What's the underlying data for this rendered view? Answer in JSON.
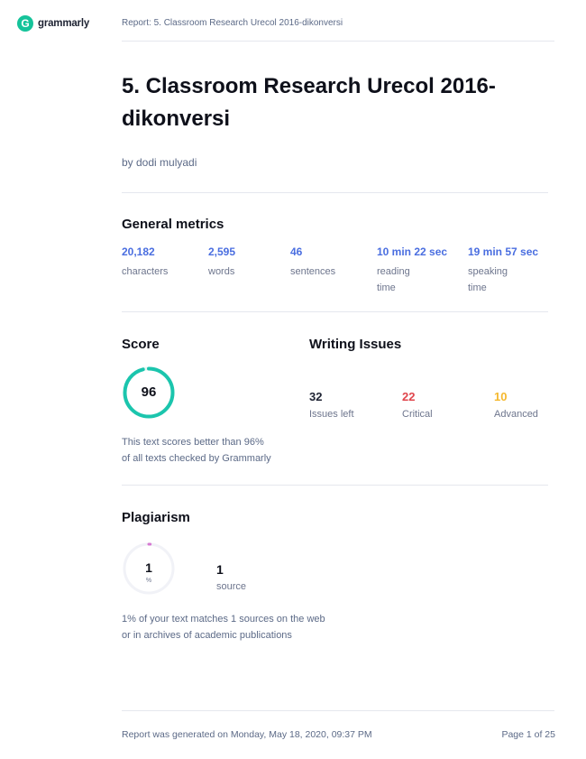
{
  "header": {
    "brand": "grammarly",
    "brand_mark": "G",
    "report_title": "Report: 5. Classroom Research Urecol 2016-dikonversi"
  },
  "document": {
    "title": "5. Classroom Research Urecol 2016-dikonversi",
    "author": "by dodi mulyadi"
  },
  "general_metrics": {
    "heading": "General metrics",
    "items": [
      {
        "value": "20,182",
        "label": "characters"
      },
      {
        "value": "2,595",
        "label": "words"
      },
      {
        "value": "46",
        "label": "sentences"
      },
      {
        "value": "10 min 22 sec",
        "label": "reading",
        "label2": "time"
      },
      {
        "value": "19 min 57 sec",
        "label": "speaking",
        "label2": "time"
      }
    ]
  },
  "score": {
    "heading": "Score",
    "value": "96",
    "percent": 96,
    "caption_line1": "This text scores better than 96%",
    "caption_line2": "of all texts checked by Grammarly"
  },
  "writing_issues": {
    "heading": "Writing Issues",
    "items": [
      {
        "value": "32",
        "label": "Issues left",
        "color": "#1d2232"
      },
      {
        "value": "22",
        "label": "Critical",
        "color": "#e0454c"
      },
      {
        "value": "10",
        "label": "Advanced",
        "color": "#f5b82e"
      }
    ]
  },
  "plagiarism": {
    "heading": "Plagiarism",
    "value": "1",
    "unit": "%",
    "percent": 1,
    "sources_value": "1",
    "sources_label": "source",
    "caption_line1": "1% of your text matches 1 sources on the web",
    "caption_line2": "or in archives of academic publications"
  },
  "footer": {
    "generated": "Report was generated on Monday, May 18, 2020, 09:37 PM",
    "page": "Page 1 of 25"
  },
  "colors": {
    "brand": "#15c39a",
    "accent": "#4a6ee0",
    "score_ring": "#1bc5ad",
    "plagiarism_ring": "#d679d2"
  }
}
